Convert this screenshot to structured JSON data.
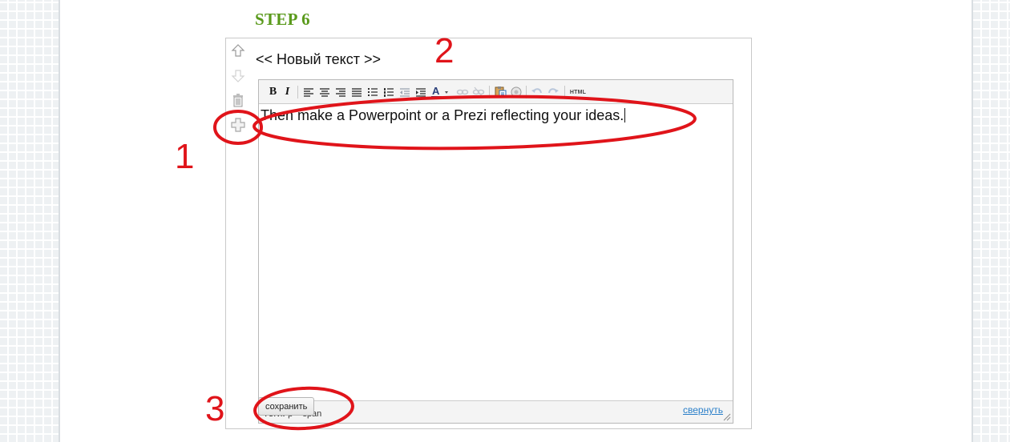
{
  "step_title": "STEP 6",
  "block": {
    "title": "<< Новый текст >>",
    "side_tools": [
      "arrow-up-icon",
      "arrow-down-icon",
      "trash-icon",
      "plus-icon"
    ]
  },
  "editor": {
    "toolbar": {
      "bold": "B",
      "italic": "I",
      "html": "HTML"
    },
    "content": "Then make a Powerpoint or a Prezi  reflecting your ideas.",
    "status": {
      "label": "Теги:",
      "path": "p » span"
    }
  },
  "actions": {
    "save_label": "сохранить",
    "collapse_label": "свернуть"
  },
  "annotations": {
    "color": "#e0141a",
    "labels": [
      "1",
      "2",
      "3"
    ]
  }
}
